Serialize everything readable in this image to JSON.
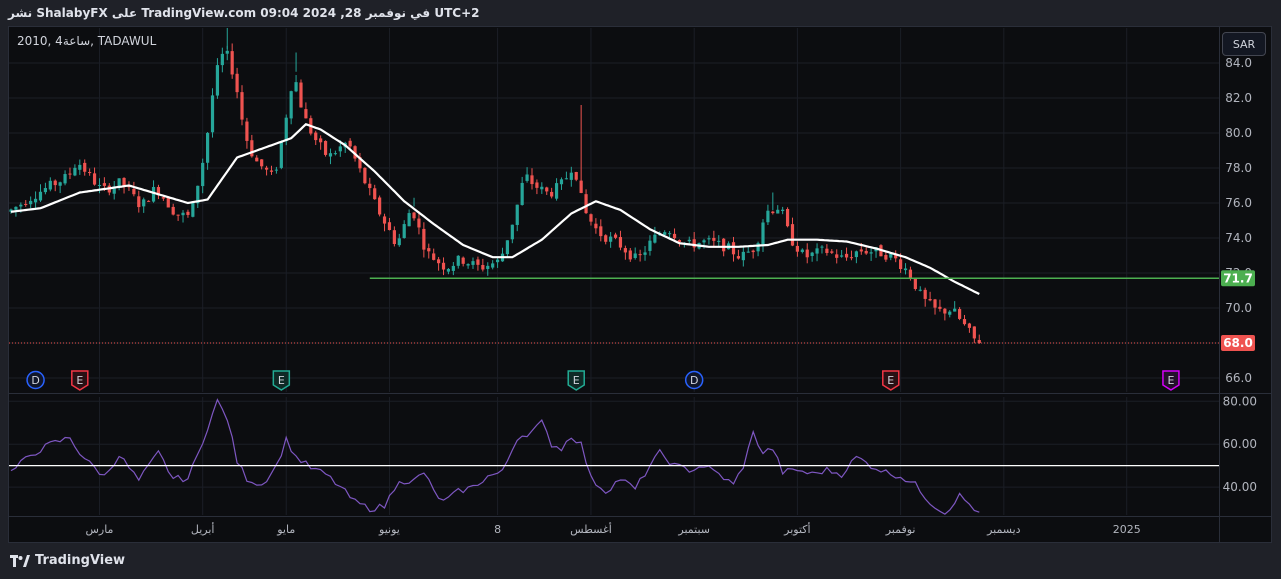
{
  "header": {
    "publish_line": "نشر ShalabyFX على TradingView.com 09:04 2024 ,28 في نوفمبر UTC+2",
    "symbol_line": "2010, 4ساعة, TADAWUL",
    "currency": "SAR",
    "brand": "TradingView"
  },
  "colors": {
    "up": "#26a69a",
    "down": "#ef5350",
    "ma": "#ffffff",
    "support": "#4caf50",
    "rsi": "#7e57c2",
    "background": "#0c0d10"
  },
  "chart_data": [
    {
      "type": "candlestick",
      "title": "",
      "ylim": [
        65.2,
        86.0
      ],
      "y_ticks": [
        "84.0",
        "82.0",
        "80.0",
        "78.0",
        "76.0",
        "74.0",
        "72.0",
        "70.0",
        "66.0"
      ],
      "x_ticks": [
        "مارس",
        "أبريل",
        "مايو",
        "يونيو",
        "8",
        "أغسطس",
        "سبتمبر",
        "أكتوبر",
        "نوفمبر",
        "ديسمبر",
        "2025"
      ],
      "anchors": [
        {
          "x": 0,
          "v": 75.5
        },
        {
          "x": 6,
          "v": 76.6
        },
        {
          "x": 12,
          "v": 77.5
        },
        {
          "x": 14,
          "v": 78.4
        },
        {
          "x": 19,
          "v": 76.7
        },
        {
          "x": 23,
          "v": 77.2
        },
        {
          "x": 27,
          "v": 75.8
        },
        {
          "x": 30,
          "v": 76.9
        },
        {
          "x": 34,
          "v": 75.4
        },
        {
          "x": 37,
          "v": 75.2
        },
        {
          "x": 40,
          "v": 79.0
        },
        {
          "x": 42,
          "v": 83.2
        },
        {
          "x": 44,
          "v": 84.8
        },
        {
          "x": 46,
          "v": 83.2
        },
        {
          "x": 48,
          "v": 80.0
        },
        {
          "x": 50,
          "v": 78.5
        },
        {
          "x": 54,
          "v": 77.4
        },
        {
          "x": 56,
          "v": 80.2
        },
        {
          "x": 58,
          "v": 83.5
        },
        {
          "x": 60,
          "v": 81.0
        },
        {
          "x": 62,
          "v": 79.8
        },
        {
          "x": 65,
          "v": 78.6
        },
        {
          "x": 69,
          "v": 79.5
        },
        {
          "x": 72,
          "v": 77.5
        },
        {
          "x": 75,
          "v": 75.7
        },
        {
          "x": 79,
          "v": 73.6
        },
        {
          "x": 82,
          "v": 75.8
        },
        {
          "x": 85,
          "v": 73.2
        },
        {
          "x": 89,
          "v": 72.3
        },
        {
          "x": 92,
          "v": 72.8
        },
        {
          "x": 96,
          "v": 72.3
        },
        {
          "x": 100,
          "v": 72.7
        },
        {
          "x": 103,
          "v": 75.3
        },
        {
          "x": 105,
          "v": 77.6
        },
        {
          "x": 107,
          "v": 77.0
        },
        {
          "x": 110,
          "v": 76.5
        },
        {
          "x": 113,
          "v": 77.2
        },
        {
          "x": 115,
          "v": 78.3
        },
        {
          "x": 117,
          "v": 75.6
        },
        {
          "x": 120,
          "v": 74.3
        },
        {
          "x": 124,
          "v": 73.7
        },
        {
          "x": 128,
          "v": 72.7
        },
        {
          "x": 131,
          "v": 73.9
        },
        {
          "x": 134,
          "v": 74.6
        },
        {
          "x": 138,
          "v": 73.6
        },
        {
          "x": 142,
          "v": 73.8
        },
        {
          "x": 146,
          "v": 73.5
        },
        {
          "x": 149,
          "v": 72.9
        },
        {
          "x": 152,
          "v": 73.5
        },
        {
          "x": 154,
          "v": 75.5
        },
        {
          "x": 157,
          "v": 75.8
        },
        {
          "x": 159,
          "v": 74.0
        },
        {
          "x": 162,
          "v": 72.9
        },
        {
          "x": 166,
          "v": 73.3
        },
        {
          "x": 170,
          "v": 72.8
        },
        {
          "x": 173,
          "v": 73.3
        },
        {
          "x": 177,
          "v": 73.2
        },
        {
          "x": 180,
          "v": 72.9
        },
        {
          "x": 183,
          "v": 72.1
        },
        {
          "x": 186,
          "v": 70.5
        },
        {
          "x": 189,
          "v": 69.8
        },
        {
          "x": 192,
          "v": 69.9
        },
        {
          "x": 195,
          "v": 68.8
        },
        {
          "x": 197,
          "v": 68.0
        }
      ],
      "moving_average": [
        {
          "x": 0,
          "v": 75.5
        },
        {
          "x": 6,
          "v": 75.7
        },
        {
          "x": 14,
          "v": 76.6
        },
        {
          "x": 24,
          "v": 77.0
        },
        {
          "x": 36,
          "v": 76.0
        },
        {
          "x": 40,
          "v": 76.2
        },
        {
          "x": 46,
          "v": 78.6
        },
        {
          "x": 52,
          "v": 79.2
        },
        {
          "x": 57,
          "v": 79.7
        },
        {
          "x": 60,
          "v": 80.5
        },
        {
          "x": 63,
          "v": 80.2
        },
        {
          "x": 68,
          "v": 79.3
        },
        {
          "x": 74,
          "v": 77.8
        },
        {
          "x": 80,
          "v": 76.1
        },
        {
          "x": 86,
          "v": 74.8
        },
        {
          "x": 92,
          "v": 73.6
        },
        {
          "x": 98,
          "v": 72.9
        },
        {
          "x": 102,
          "v": 72.9
        },
        {
          "x": 108,
          "v": 73.9
        },
        {
          "x": 114,
          "v": 75.4
        },
        {
          "x": 119,
          "v": 76.1
        },
        {
          "x": 124,
          "v": 75.6
        },
        {
          "x": 130,
          "v": 74.5
        },
        {
          "x": 136,
          "v": 73.7
        },
        {
          "x": 142,
          "v": 73.5
        },
        {
          "x": 148,
          "v": 73.5
        },
        {
          "x": 154,
          "v": 73.6
        },
        {
          "x": 158,
          "v": 73.9
        },
        {
          "x": 164,
          "v": 73.9
        },
        {
          "x": 170,
          "v": 73.8
        },
        {
          "x": 176,
          "v": 73.4
        },
        {
          "x": 182,
          "v": 72.9
        },
        {
          "x": 187,
          "v": 72.3
        },
        {
          "x": 192,
          "v": 71.5
        },
        {
          "x": 197,
          "v": 70.8
        }
      ],
      "support_level": 71.7,
      "support_label": "71.7",
      "last_price": 68.0,
      "last_price_label": "68.0",
      "event_markers": [
        {
          "x": 5,
          "label": "D",
          "kind": "dividend-past"
        },
        {
          "x": 14,
          "label": "E",
          "kind": "earnings-miss"
        },
        {
          "x": 55,
          "label": "E",
          "kind": "earnings-beat"
        },
        {
          "x": 115,
          "label": "E",
          "kind": "earnings-beat"
        },
        {
          "x": 139,
          "label": "D",
          "kind": "dividend-past"
        },
        {
          "x": 179,
          "label": "E",
          "kind": "earnings-miss"
        },
        {
          "x": 236,
          "label": "E",
          "kind": "earnings-upcoming"
        }
      ]
    },
    {
      "type": "line",
      "title": "",
      "ylim": [
        27,
        82
      ],
      "y_ticks": [
        "80.00",
        "60.00",
        "40.00"
      ],
      "reference_level": 50,
      "series": [
        {
          "values": [
            {
              "x": 0,
              "v": 47
            },
            {
              "x": 4,
              "v": 55
            },
            {
              "x": 8,
              "v": 60
            },
            {
              "x": 12,
              "v": 63
            },
            {
              "x": 14,
              "v": 56
            },
            {
              "x": 16,
              "v": 51
            },
            {
              "x": 19,
              "v": 45
            },
            {
              "x": 22,
              "v": 55
            },
            {
              "x": 26,
              "v": 43
            },
            {
              "x": 30,
              "v": 56
            },
            {
              "x": 33,
              "v": 44
            },
            {
              "x": 36,
              "v": 44
            },
            {
              "x": 38,
              "v": 55
            },
            {
              "x": 40,
              "v": 68
            },
            {
              "x": 42,
              "v": 80
            },
            {
              "x": 44,
              "v": 72
            },
            {
              "x": 46,
              "v": 52
            },
            {
              "x": 48,
              "v": 44
            },
            {
              "x": 51,
              "v": 41
            },
            {
              "x": 54,
              "v": 50
            },
            {
              "x": 56,
              "v": 62
            },
            {
              "x": 58,
              "v": 54
            },
            {
              "x": 61,
              "v": 49
            },
            {
              "x": 64,
              "v": 46
            },
            {
              "x": 67,
              "v": 40
            },
            {
              "x": 70,
              "v": 33
            },
            {
              "x": 73,
              "v": 30
            },
            {
              "x": 76,
              "v": 31
            },
            {
              "x": 79,
              "v": 44
            },
            {
              "x": 81,
              "v": 41
            },
            {
              "x": 84,
              "v": 47
            },
            {
              "x": 86,
              "v": 38
            },
            {
              "x": 88,
              "v": 33
            },
            {
              "x": 91,
              "v": 38
            },
            {
              "x": 94,
              "v": 40
            },
            {
              "x": 97,
              "v": 45
            },
            {
              "x": 100,
              "v": 47
            },
            {
              "x": 103,
              "v": 63
            },
            {
              "x": 106,
              "v": 66
            },
            {
              "x": 108,
              "v": 70
            },
            {
              "x": 110,
              "v": 60
            },
            {
              "x": 112,
              "v": 58
            },
            {
              "x": 114,
              "v": 64
            },
            {
              "x": 116,
              "v": 60
            },
            {
              "x": 118,
              "v": 44
            },
            {
              "x": 121,
              "v": 38
            },
            {
              "x": 124,
              "v": 44
            },
            {
              "x": 127,
              "v": 39
            },
            {
              "x": 130,
              "v": 50
            },
            {
              "x": 132,
              "v": 56
            },
            {
              "x": 135,
              "v": 50
            },
            {
              "x": 138,
              "v": 48
            },
            {
              "x": 141,
              "v": 50
            },
            {
              "x": 144,
              "v": 46
            },
            {
              "x": 147,
              "v": 41
            },
            {
              "x": 149,
              "v": 50
            },
            {
              "x": 151,
              "v": 65
            },
            {
              "x": 153,
              "v": 56
            },
            {
              "x": 155,
              "v": 58
            },
            {
              "x": 157,
              "v": 47
            },
            {
              "x": 160,
              "v": 48
            },
            {
              "x": 163,
              "v": 46
            },
            {
              "x": 166,
              "v": 48
            },
            {
              "x": 169,
              "v": 46
            },
            {
              "x": 172,
              "v": 54
            },
            {
              "x": 175,
              "v": 50
            },
            {
              "x": 178,
              "v": 47
            },
            {
              "x": 181,
              "v": 45
            },
            {
              "x": 184,
              "v": 41
            },
            {
              "x": 187,
              "v": 33
            },
            {
              "x": 190,
              "v": 28
            },
            {
              "x": 193,
              "v": 36
            },
            {
              "x": 196,
              "v": 30
            },
            {
              "x": 197,
              "v": 27
            }
          ]
        }
      ]
    }
  ]
}
